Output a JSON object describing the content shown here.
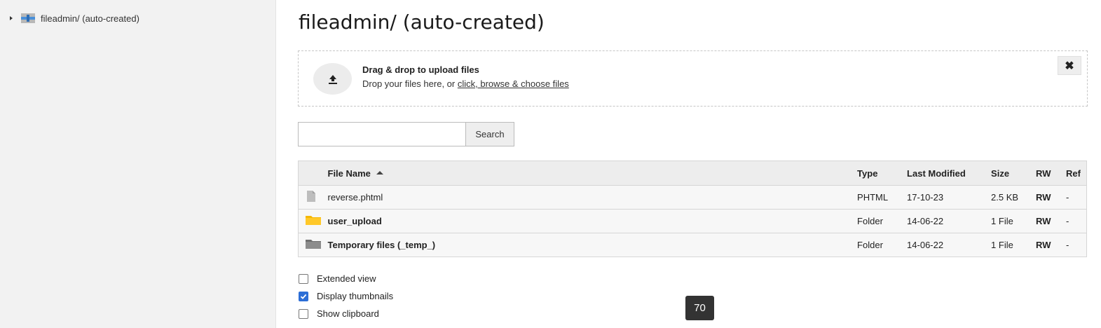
{
  "tree": {
    "root_label": "fileadmin/ (auto-created)"
  },
  "page": {
    "title": "fileadmin/ (auto-created)"
  },
  "dropzone": {
    "title": "Drag & drop to upload files",
    "subtitle_prefix": "Drop your files here, or ",
    "link_text": "click, browse & choose files",
    "close_glyph": "✖"
  },
  "search": {
    "value": "",
    "button_label": "Search"
  },
  "table": {
    "headers": {
      "name": "File Name",
      "type": "Type",
      "modified": "Last Modified",
      "size": "Size",
      "rw": "RW",
      "ref": "Ref"
    },
    "rows": [
      {
        "icon": "file-icon",
        "name": "reverse.phtml",
        "type": "PHTML",
        "modified": "17-10-23",
        "size": "2.5 KB",
        "rw": "RW",
        "ref": "-"
      },
      {
        "icon": "folder-icon",
        "name": "user_upload",
        "type": "Folder",
        "modified": "14-06-22",
        "size": "1 File",
        "rw": "RW",
        "ref": "-"
      },
      {
        "icon": "temp-folder-icon",
        "name": "Temporary files (_temp_)",
        "type": "Folder",
        "modified": "14-06-22",
        "size": "1 File",
        "rw": "RW",
        "ref": "-"
      }
    ]
  },
  "options": {
    "extended_view": {
      "label": "Extended view",
      "checked": false
    },
    "display_thumbnails": {
      "label": "Display thumbnails",
      "checked": true
    },
    "show_clipboard": {
      "label": "Show clipboard",
      "checked": false
    }
  },
  "tooltip": {
    "text": "70"
  },
  "colors": {
    "rw": "#c83c3c",
    "checkbox_checked": "#2c6ed6",
    "folder": "#f5b700"
  }
}
